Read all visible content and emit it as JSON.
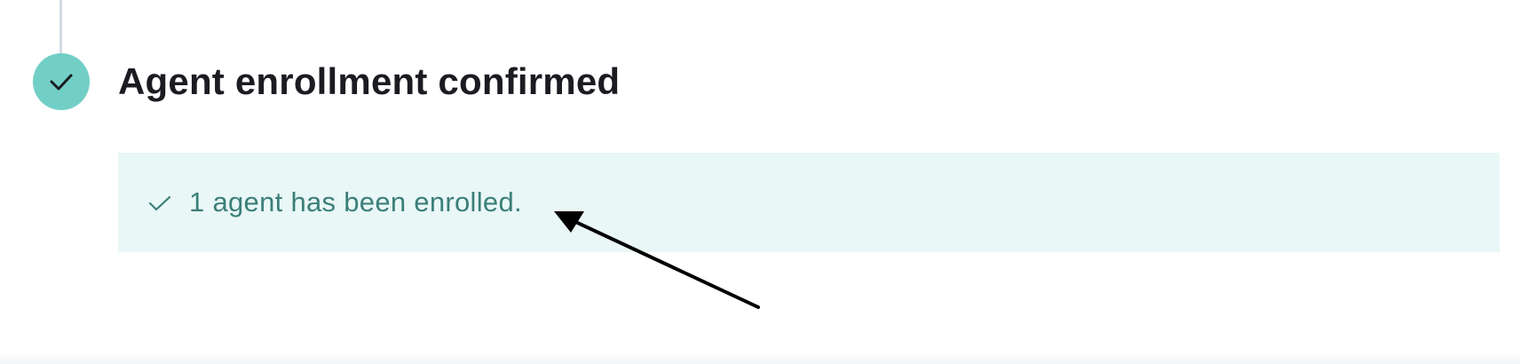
{
  "step": {
    "title": "Agent enrollment confirmed",
    "status_icon": "check-icon",
    "status_color": "#72cfc6"
  },
  "callout": {
    "message": "1 agent has been enrolled.",
    "icon": "check-icon",
    "background": "#e9f7f6",
    "text_color": "#3b7f79"
  },
  "annotation": {
    "icon": "arrow-annotation"
  }
}
